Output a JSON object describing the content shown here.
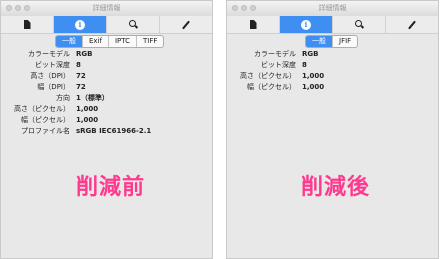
{
  "left_panel": {
    "title": "詳細情報",
    "tabs": [
      "一般",
      "Exif",
      "IPTC",
      "TIFF"
    ],
    "active_tab": "一般",
    "rows": [
      {
        "label": "カラーモデル",
        "value": "RGB"
      },
      {
        "label": "ビット深度",
        "value": "8"
      },
      {
        "label": "高さ（DPI）",
        "value": "72"
      },
      {
        "label": "幅（DPI）",
        "value": "72"
      },
      {
        "label": "方向",
        "value": "1（標準）"
      },
      {
        "label": "高さ（ピクセル）",
        "value": "1,000"
      },
      {
        "label": "幅（ピクセル）",
        "value": "1,000"
      },
      {
        "label": "プロファイル名",
        "value": "sRGB IEC61966-2.1"
      }
    ],
    "caption": "削減前"
  },
  "right_panel": {
    "title": "詳細情報",
    "tabs": [
      "一般",
      "JFIF"
    ],
    "active_tab": "一般",
    "rows": [
      {
        "label": "カラーモデル",
        "value": "RGB"
      },
      {
        "label": "ビット深度",
        "value": "8"
      },
      {
        "label": "高さ（ピクセル）",
        "value": "1,000"
      },
      {
        "label": "幅（ピクセル）",
        "value": "1,000"
      }
    ],
    "caption": "削減後"
  },
  "toolbar_icons": [
    "document-icon",
    "info-icon",
    "search-icon",
    "pencil-icon"
  ],
  "colors": {
    "accent": "#3f8ff3",
    "caption": "#ff3a8e",
    "panel_bg": "#e8e8e8"
  }
}
